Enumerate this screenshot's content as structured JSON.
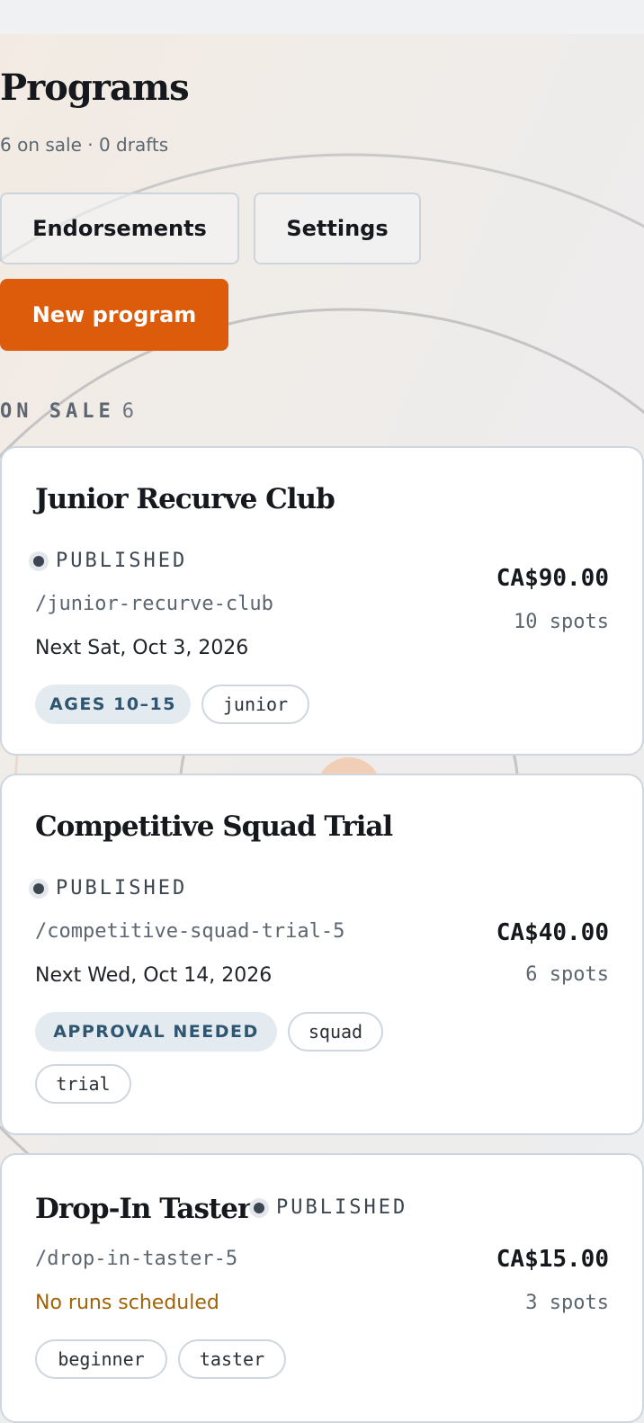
{
  "header": {
    "title": "Programs",
    "subtitle": "6 on sale · 0 drafts"
  },
  "actions": {
    "endorsements": "Endorsements",
    "settings": "Settings",
    "new_program": "New program"
  },
  "section": {
    "label": "ON SALE",
    "count": "6"
  },
  "programs": [
    {
      "title": "Junior Recurve Club",
      "status": "PUBLISHED",
      "slug": "/junior-recurve-club",
      "next_run": "Next Sat, Oct 3, 2026",
      "price": "CA$90.00",
      "spots": "10 spots",
      "badge": "AGES 10–15",
      "tags": [
        "junior"
      ]
    },
    {
      "title": "Competitive Squad Trial",
      "status": "PUBLISHED",
      "slug": "/competitive-squad-trial-5",
      "next_run": "Next Wed, Oct 14, 2026",
      "price": "CA$40.00",
      "spots": "6 spots",
      "badge": "APPROVAL NEEDED",
      "tags": [
        "squad",
        "trial"
      ]
    },
    {
      "title": "Drop-In Taster",
      "status": "PUBLISHED",
      "slug": "/drop-in-taster-5",
      "next_run": "No runs scheduled",
      "price": "CA$15.00",
      "spots": "3 spots",
      "tags": [
        "beginner",
        "taster"
      ]
    }
  ],
  "colors": {
    "accent": "#dc5c0c",
    "status_dot": "#3c4650",
    "badge_bg": "#e3eaf0",
    "badge_text": "#2e5670",
    "warning_text": "#a06408"
  },
  "icons": {
    "status": "status-dot-icon"
  }
}
